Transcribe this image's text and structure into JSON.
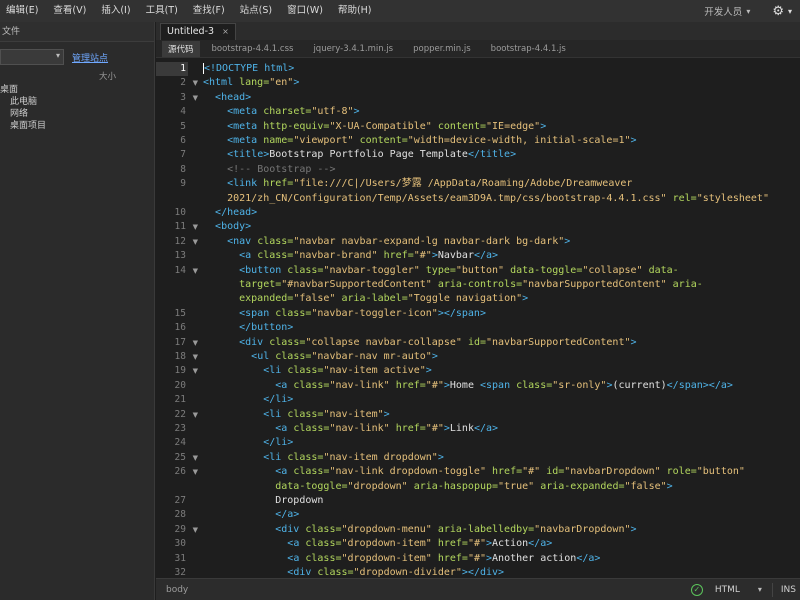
{
  "menubar": {
    "items": [
      "编辑(E)",
      "查看(V)",
      "插入(I)",
      "工具(T)",
      "查找(F)",
      "站点(S)",
      "窗口(W)",
      "帮助(H)"
    ],
    "workspace": "开发人员",
    "workspace_caret": "▾",
    "gear_icon": "⚙",
    "gear_caret": "▾"
  },
  "left_panel": {
    "title": "文件",
    "manage_sites": "管理站点",
    "size_header": "大小",
    "name_header": "",
    "tree": [
      "桌面",
      "此电脑",
      "网络",
      "桌面项目"
    ]
  },
  "doc_tab": {
    "name": "Untitled-3",
    "close": "×"
  },
  "related_files": [
    "源代码",
    "bootstrap-4.4.1.css",
    "jquery-3.4.1.min.js",
    "popper.min.js",
    "bootstrap-4.4.1.js"
  ],
  "editor": {
    "active_line": 1,
    "lines": [
      {
        "n": "1",
        "fold": "",
        "tokens": [
          [
            "tag",
            "<!DOCTYPE html>"
          ]
        ]
      },
      {
        "n": "2",
        "fold": "▼",
        "tokens": [
          [
            "tag",
            "<html "
          ],
          [
            "attr",
            "lang="
          ],
          [
            "str",
            "\"en\""
          ],
          [
            "tag",
            ">"
          ]
        ]
      },
      {
        "n": "3",
        "fold": "▼",
        "tokens": [
          [
            "txt",
            "  "
          ],
          [
            "tag",
            "<head>"
          ]
        ]
      },
      {
        "n": "4",
        "fold": "",
        "tokens": [
          [
            "txt",
            "    "
          ],
          [
            "tag",
            "<meta "
          ],
          [
            "attr",
            "charset="
          ],
          [
            "str",
            "\"utf-8\""
          ],
          [
            "tag",
            ">"
          ]
        ]
      },
      {
        "n": "5",
        "fold": "",
        "tokens": [
          [
            "txt",
            "    "
          ],
          [
            "tag",
            "<meta "
          ],
          [
            "attr",
            "http-equiv="
          ],
          [
            "str",
            "\"X-UA-Compatible\""
          ],
          [
            "txt",
            " "
          ],
          [
            "attr",
            "content="
          ],
          [
            "str",
            "\"IE=edge\""
          ],
          [
            "tag",
            ">"
          ]
        ]
      },
      {
        "n": "6",
        "fold": "",
        "tokens": [
          [
            "txt",
            "    "
          ],
          [
            "tag",
            "<meta "
          ],
          [
            "attr",
            "name="
          ],
          [
            "str",
            "\"viewport\""
          ],
          [
            "txt",
            " "
          ],
          [
            "attr",
            "content="
          ],
          [
            "str",
            "\"width=device-width, initial-scale=1\""
          ],
          [
            "tag",
            ">"
          ]
        ]
      },
      {
        "n": "7",
        "fold": "",
        "tokens": [
          [
            "txt",
            "    "
          ],
          [
            "tag",
            "<title>"
          ],
          [
            "txt",
            "Bootstrap Portfolio Page Template"
          ],
          [
            "tag",
            "</title>"
          ]
        ]
      },
      {
        "n": "8",
        "fold": "",
        "tokens": [
          [
            "txt",
            "    "
          ],
          [
            "com",
            "<!-- Bootstrap -->"
          ]
        ]
      },
      {
        "n": "9",
        "fold": "",
        "tokens": [
          [
            "txt",
            "    "
          ],
          [
            "tag",
            "<link "
          ],
          [
            "attr",
            "href="
          ],
          [
            "str",
            "\"file:///C|/Users/梦露 /AppData/Roaming/Adobe/Dreamweaver"
          ]
        ]
      },
      {
        "n": "",
        "fold": "",
        "tokens": [
          [
            "str",
            "    2021/zh_CN/Configuration/Temp/Assets/eam3D9A.tmp/css/bootstrap-4.4.1.css\""
          ],
          [
            "txt",
            " "
          ],
          [
            "attr",
            "rel="
          ],
          [
            "str",
            "\"stylesheet\""
          ]
        ]
      },
      {
        "n": "10",
        "fold": "",
        "tokens": [
          [
            "txt",
            "  "
          ],
          [
            "tag",
            "</head>"
          ]
        ]
      },
      {
        "n": "11",
        "fold": "▼",
        "tokens": [
          [
            "txt",
            "  "
          ],
          [
            "tag",
            "<body>"
          ]
        ]
      },
      {
        "n": "12",
        "fold": "▼",
        "tokens": [
          [
            "txt",
            "    "
          ],
          [
            "tag",
            "<nav "
          ],
          [
            "attr",
            "class="
          ],
          [
            "str",
            "\"navbar navbar-expand-lg navbar-dark bg-dark\""
          ],
          [
            "tag",
            ">"
          ]
        ]
      },
      {
        "n": "13",
        "fold": "",
        "tokens": [
          [
            "txt",
            "      "
          ],
          [
            "tag",
            "<a "
          ],
          [
            "attr",
            "class="
          ],
          [
            "str",
            "\"navbar-brand\""
          ],
          [
            "txt",
            " "
          ],
          [
            "attr",
            "href="
          ],
          [
            "str",
            "\"#\""
          ],
          [
            "tag",
            ">"
          ],
          [
            "txt",
            "Navbar"
          ],
          [
            "tag",
            "</a>"
          ]
        ]
      },
      {
        "n": "14",
        "fold": "▼",
        "tokens": [
          [
            "txt",
            "      "
          ],
          [
            "tag",
            "<button "
          ],
          [
            "attr",
            "class="
          ],
          [
            "str",
            "\"navbar-toggler\""
          ],
          [
            "txt",
            " "
          ],
          [
            "attr",
            "type="
          ],
          [
            "str",
            "\"button\""
          ],
          [
            "txt",
            " "
          ],
          [
            "attr",
            "data-toggle="
          ],
          [
            "str",
            "\"collapse\""
          ],
          [
            "txt",
            " "
          ],
          [
            "attr",
            "data-"
          ]
        ]
      },
      {
        "n": "",
        "fold": "",
        "tokens": [
          [
            "txt",
            "      "
          ],
          [
            "attr",
            "target="
          ],
          [
            "str",
            "\"#navbarSupportedContent\""
          ],
          [
            "txt",
            " "
          ],
          [
            "attr",
            "aria-controls="
          ],
          [
            "str",
            "\"navbarSupportedContent\""
          ],
          [
            "txt",
            " "
          ],
          [
            "attr",
            "aria-"
          ]
        ]
      },
      {
        "n": "",
        "fold": "",
        "tokens": [
          [
            "txt",
            "      "
          ],
          [
            "attr",
            "expanded="
          ],
          [
            "str",
            "\"false\""
          ],
          [
            "txt",
            " "
          ],
          [
            "attr",
            "aria-label="
          ],
          [
            "str",
            "\"Toggle navigation\""
          ],
          [
            "tag",
            ">"
          ]
        ]
      },
      {
        "n": "15",
        "fold": "",
        "tokens": [
          [
            "txt",
            "      "
          ],
          [
            "tag",
            "<span "
          ],
          [
            "attr",
            "class="
          ],
          [
            "str",
            "\"navbar-toggler-icon\""
          ],
          [
            "tag",
            "></span>"
          ]
        ]
      },
      {
        "n": "16",
        "fold": "",
        "tokens": [
          [
            "txt",
            "      "
          ],
          [
            "tag",
            "</button>"
          ]
        ]
      },
      {
        "n": "17",
        "fold": "▼",
        "tokens": [
          [
            "txt",
            "      "
          ],
          [
            "tag",
            "<div "
          ],
          [
            "attr",
            "class="
          ],
          [
            "str",
            "\"collapse navbar-collapse\""
          ],
          [
            "txt",
            " "
          ],
          [
            "attr",
            "id="
          ],
          [
            "str",
            "\"navbarSupportedContent\""
          ],
          [
            "tag",
            ">"
          ]
        ]
      },
      {
        "n": "18",
        "fold": "▼",
        "tokens": [
          [
            "txt",
            "        "
          ],
          [
            "tag",
            "<ul "
          ],
          [
            "attr",
            "class="
          ],
          [
            "str",
            "\"navbar-nav mr-auto\""
          ],
          [
            "tag",
            ">"
          ]
        ]
      },
      {
        "n": "19",
        "fold": "▼",
        "tokens": [
          [
            "txt",
            "          "
          ],
          [
            "tag",
            "<li "
          ],
          [
            "attr",
            "class="
          ],
          [
            "str",
            "\"nav-item active\""
          ],
          [
            "tag",
            ">"
          ]
        ]
      },
      {
        "n": "20",
        "fold": "",
        "tokens": [
          [
            "txt",
            "            "
          ],
          [
            "tag",
            "<a "
          ],
          [
            "attr",
            "class="
          ],
          [
            "str",
            "\"nav-link\""
          ],
          [
            "txt",
            " "
          ],
          [
            "attr",
            "href="
          ],
          [
            "str",
            "\"#\""
          ],
          [
            "tag",
            ">"
          ],
          [
            "txt",
            "Home "
          ],
          [
            "tag",
            "<span "
          ],
          [
            "attr",
            "class="
          ],
          [
            "str",
            "\"sr-only\""
          ],
          [
            "tag",
            ">"
          ],
          [
            "txt",
            "(current)"
          ],
          [
            "tag",
            "</span></a>"
          ]
        ]
      },
      {
        "n": "21",
        "fold": "",
        "tokens": [
          [
            "txt",
            "          "
          ],
          [
            "tag",
            "</li>"
          ]
        ]
      },
      {
        "n": "22",
        "fold": "▼",
        "tokens": [
          [
            "txt",
            "          "
          ],
          [
            "tag",
            "<li "
          ],
          [
            "attr",
            "class="
          ],
          [
            "str",
            "\"nav-item\""
          ],
          [
            "tag",
            ">"
          ]
        ]
      },
      {
        "n": "23",
        "fold": "",
        "tokens": [
          [
            "txt",
            "            "
          ],
          [
            "tag",
            "<a "
          ],
          [
            "attr",
            "class="
          ],
          [
            "str",
            "\"nav-link\""
          ],
          [
            "txt",
            " "
          ],
          [
            "attr",
            "href="
          ],
          [
            "str",
            "\"#\""
          ],
          [
            "tag",
            ">"
          ],
          [
            "txt",
            "Link"
          ],
          [
            "tag",
            "</a>"
          ]
        ]
      },
      {
        "n": "24",
        "fold": "",
        "tokens": [
          [
            "txt",
            "          "
          ],
          [
            "tag",
            "</li>"
          ]
        ]
      },
      {
        "n": "25",
        "fold": "▼",
        "tokens": [
          [
            "txt",
            "          "
          ],
          [
            "tag",
            "<li "
          ],
          [
            "attr",
            "class="
          ],
          [
            "str",
            "\"nav-item dropdown\""
          ],
          [
            "tag",
            ">"
          ]
        ]
      },
      {
        "n": "26",
        "fold": "▼",
        "tokens": [
          [
            "txt",
            "            "
          ],
          [
            "tag",
            "<a "
          ],
          [
            "attr",
            "class="
          ],
          [
            "str",
            "\"nav-link dropdown-toggle\""
          ],
          [
            "txt",
            " "
          ],
          [
            "attr",
            "href="
          ],
          [
            "str",
            "\"#\""
          ],
          [
            "txt",
            " "
          ],
          [
            "attr",
            "id="
          ],
          [
            "str",
            "\"navbarDropdown\""
          ],
          [
            "txt",
            " "
          ],
          [
            "attr",
            "role="
          ],
          [
            "str",
            "\"button\""
          ]
        ]
      },
      {
        "n": "",
        "fold": "",
        "tokens": [
          [
            "txt",
            "            "
          ],
          [
            "attr",
            "data-toggle="
          ],
          [
            "str",
            "\"dropdown\""
          ],
          [
            "txt",
            " "
          ],
          [
            "attr",
            "aria-haspopup="
          ],
          [
            "str",
            "\"true\""
          ],
          [
            "txt",
            " "
          ],
          [
            "attr",
            "aria-expanded="
          ],
          [
            "str",
            "\"false\""
          ],
          [
            "tag",
            ">"
          ]
        ]
      },
      {
        "n": "27",
        "fold": "",
        "tokens": [
          [
            "txt",
            "            Dropdown"
          ]
        ]
      },
      {
        "n": "28",
        "fold": "",
        "tokens": [
          [
            "txt",
            "            "
          ],
          [
            "tag",
            "</a>"
          ]
        ]
      },
      {
        "n": "29",
        "fold": "▼",
        "tokens": [
          [
            "txt",
            "            "
          ],
          [
            "tag",
            "<div "
          ],
          [
            "attr",
            "class="
          ],
          [
            "str",
            "\"dropdown-menu\""
          ],
          [
            "txt",
            " "
          ],
          [
            "attr",
            "aria-labelledby="
          ],
          [
            "str",
            "\"navbarDropdown\""
          ],
          [
            "tag",
            ">"
          ]
        ]
      },
      {
        "n": "30",
        "fold": "",
        "tokens": [
          [
            "txt",
            "              "
          ],
          [
            "tag",
            "<a "
          ],
          [
            "attr",
            "class="
          ],
          [
            "str",
            "\"dropdown-item\""
          ],
          [
            "txt",
            " "
          ],
          [
            "attr",
            "href="
          ],
          [
            "str",
            "\"#\""
          ],
          [
            "tag",
            ">"
          ],
          [
            "txt",
            "Action"
          ],
          [
            "tag",
            "</a>"
          ]
        ]
      },
      {
        "n": "31",
        "fold": "",
        "tokens": [
          [
            "txt",
            "              "
          ],
          [
            "tag",
            "<a "
          ],
          [
            "attr",
            "class="
          ],
          [
            "str",
            "\"dropdown-item\""
          ],
          [
            "txt",
            " "
          ],
          [
            "attr",
            "href="
          ],
          [
            "str",
            "\"#\""
          ],
          [
            "tag",
            ">"
          ],
          [
            "txt",
            "Another action"
          ],
          [
            "tag",
            "</a>"
          ]
        ]
      },
      {
        "n": "32",
        "fold": "",
        "tokens": [
          [
            "txt",
            "              "
          ],
          [
            "tag",
            "<div "
          ],
          [
            "attr",
            "class="
          ],
          [
            "str",
            "\"dropdown-divider\""
          ],
          [
            "tag",
            "></div>"
          ]
        ]
      }
    ]
  },
  "statusbar": {
    "breadcrumb": "body",
    "doc_type": "HTML",
    "doc_type_caret": "▾",
    "mode": "INS",
    "check_icon": "✓"
  }
}
